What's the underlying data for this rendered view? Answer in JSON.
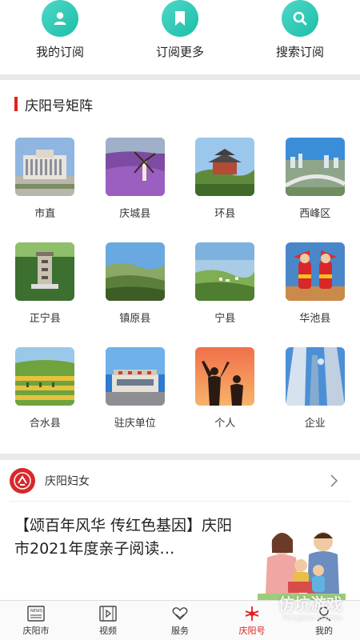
{
  "quick_actions": [
    {
      "label": "我的订阅",
      "icon": "user-icon"
    },
    {
      "label": "订阅更多",
      "icon": "bookmark-icon"
    },
    {
      "label": "搜索订阅",
      "icon": "search-icon"
    }
  ],
  "matrix": {
    "title": "庆阳号矩阵",
    "items": [
      {
        "label": "市直"
      },
      {
        "label": "庆城县"
      },
      {
        "label": "环县"
      },
      {
        "label": "西峰区"
      },
      {
        "label": "正宁县"
      },
      {
        "label": "镇原县"
      },
      {
        "label": "宁县"
      },
      {
        "label": "华池县"
      },
      {
        "label": "合水县"
      },
      {
        "label": "驻庆单位"
      },
      {
        "label": "个人"
      },
      {
        "label": "企业"
      }
    ]
  },
  "news": {
    "source": "庆阳妇女",
    "article_title": "【颂百年风华 传红色基因】庆阳市2021年度亲子阅读…"
  },
  "tabbar": [
    {
      "label": "庆阳市",
      "icon": "news-icon",
      "active": false
    },
    {
      "label": "视频",
      "icon": "video-icon",
      "active": false
    },
    {
      "label": "服务",
      "icon": "heart-hands-icon",
      "active": false
    },
    {
      "label": "庆阳号",
      "icon": "qingyang-logo-icon",
      "active": true
    },
    {
      "label": "我的",
      "icon": "profile-icon",
      "active": false
    }
  ],
  "watermark": {
    "main": "仿坑游戏",
    "sub": "Fengwan Games"
  },
  "colors": {
    "accent": "#e0201e",
    "teal": "#1bbfa7"
  }
}
